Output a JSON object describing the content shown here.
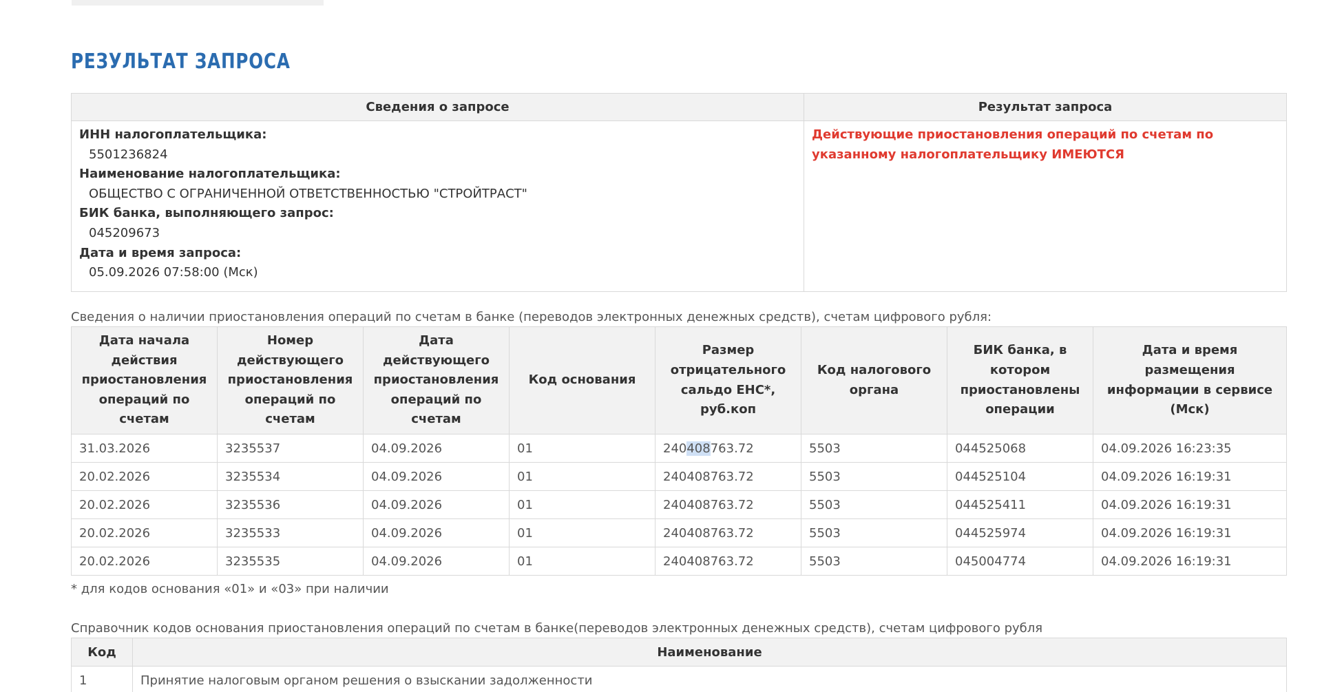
{
  "page_title": "РЕЗУЛЬТАТ ЗАПРОСА",
  "info": {
    "col_request": "Сведения о запросе",
    "col_result": "Результат запроса",
    "inn_label": "ИНН налогоплательщика:",
    "inn_value": "5501236824",
    "name_label": "Наименование налогоплательщика:",
    "name_value": "ОБЩЕСТВО С ОГРАНИЧЕННОЙ ОТВЕТСТВЕННОСТЬЮ \"СТРОЙТРАСТ\"",
    "bik_label": "БИК банка, выполняющего запрос:",
    "bik_value": "045209673",
    "datetime_label": "Дата и время запроса:",
    "datetime_value": "05.09.2026 07:58:00 (Мск)",
    "result_text": "Действующие приостановления операций по счетам по указанному налогоплательщику ИМЕЮТСЯ"
  },
  "suspensions": {
    "caption": "Сведения о наличии приостановления операций по счетам в банке (переводов электронных денежных средств), счетам цифрового рубля:",
    "headers": [
      "Дата начала действия приостановления операций по счетам",
      "Номер действующего приостановления операций по счетам",
      "Дата действующего приостановления операций по счетам",
      "Код основания",
      "Размер отрицательного сальдо ЕНС*, руб.коп",
      "Код налогового органа",
      "БИК банка, в котором приостановлены операции",
      "Дата и время размещения информации в сервисе (Мск)"
    ],
    "rows": [
      [
        "31.03.2026",
        "3235537",
        "04.09.2026",
        "01",
        "240408763.72",
        "5503",
        "044525068",
        "04.09.2026 16:23:35"
      ],
      [
        "20.02.2026",
        "3235534",
        "04.09.2026",
        "01",
        "240408763.72",
        "5503",
        "044525104",
        "04.09.2026 16:19:31"
      ],
      [
        "20.02.2026",
        "3235536",
        "04.09.2026",
        "01",
        "240408763.72",
        "5503",
        "044525411",
        "04.09.2026 16:19:31"
      ],
      [
        "20.02.2026",
        "3235533",
        "04.09.2026",
        "01",
        "240408763.72",
        "5503",
        "044525974",
        "04.09.2026 16:19:31"
      ],
      [
        "20.02.2026",
        "3235535",
        "04.09.2026",
        "01",
        "240408763.72",
        "5503",
        "045004774",
        "04.09.2026 16:19:31"
      ]
    ],
    "footnote": "* для кодов основания «01» и «03» при наличии"
  },
  "codes": {
    "caption": "Справочник кодов основания приостановления операций по счетам в банке(переводов электронных денежных средств), счетам цифрового рубля",
    "headers": [
      "Код",
      "Наименование"
    ],
    "rows": [
      [
        "1",
        "Принятие налоговым органом решения о взыскании задолженности"
      ]
    ]
  },
  "colors": {
    "title": "#2b6cb0",
    "result_alert": "#e03a2f",
    "header_bg": "#f2f2f2",
    "border": "#d9d9d9"
  }
}
